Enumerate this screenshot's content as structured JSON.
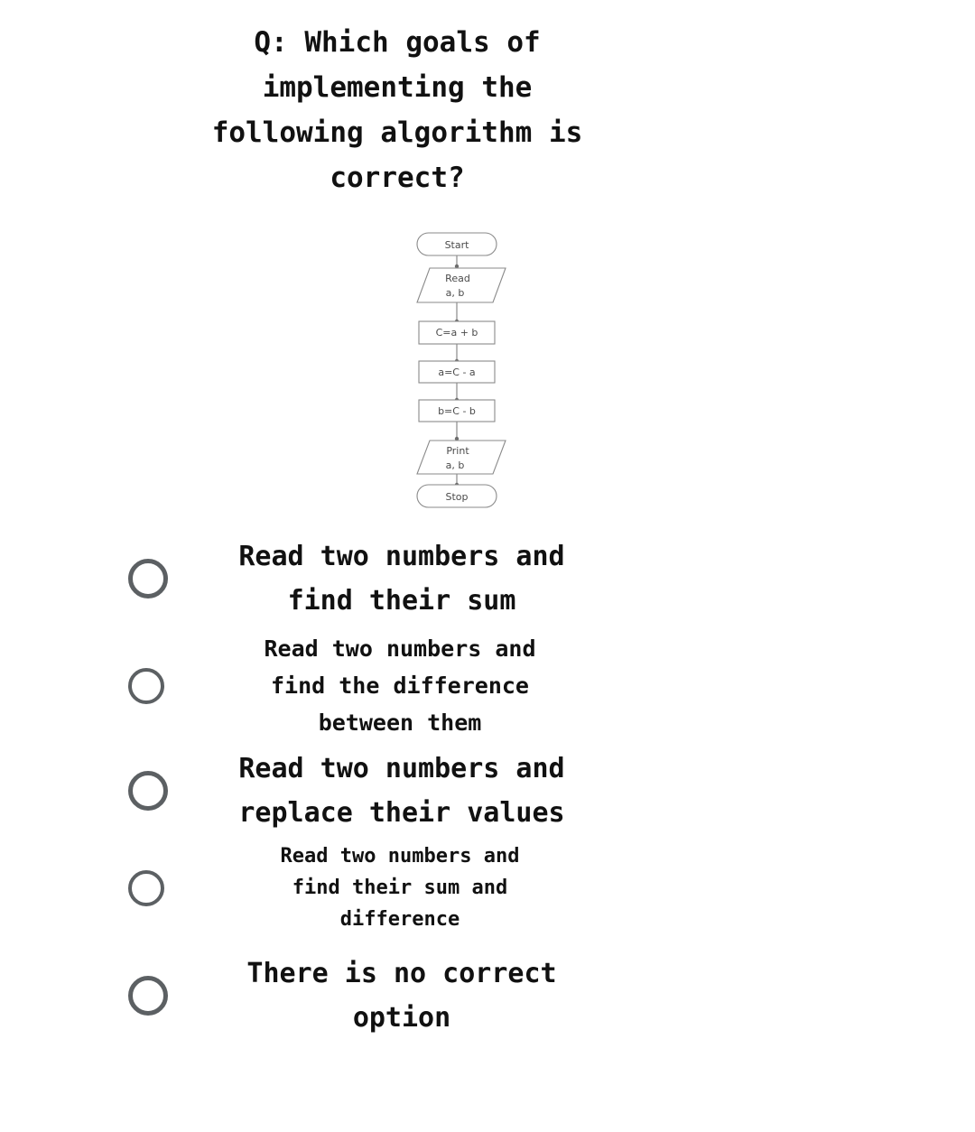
{
  "question": {
    "text": "Q: Which goals of\nimplementing the\nfollowing algorithm is\ncorrect?"
  },
  "flowchart": {
    "nodes": [
      {
        "id": "start",
        "shape": "terminator",
        "label": "Start"
      },
      {
        "id": "read",
        "shape": "parallelogram",
        "label": "Read\na, b"
      },
      {
        "id": "sum",
        "shape": "process",
        "label": "C=a + b"
      },
      {
        "id": "seta",
        "shape": "process",
        "label": "a=C - a"
      },
      {
        "id": "setb",
        "shape": "process",
        "label": "b=C - b"
      },
      {
        "id": "print",
        "shape": "parallelogram",
        "label": "Print\na, b"
      },
      {
        "id": "stop",
        "shape": "terminator",
        "label": "Stop"
      }
    ],
    "labels": {
      "start": "Start",
      "read_line1": "Read",
      "read_line2": "a, b",
      "sum": "C=a + b",
      "seta": "a=C - a",
      "setb": "b=C - b",
      "print_line1": "Print",
      "print_line2": "a, b",
      "stop": "Stop"
    },
    "colors": {
      "stroke": "#8a8a8a",
      "text": "#4a4a4a",
      "fill": "#ffffff"
    }
  },
  "options": [
    {
      "id": "option-1",
      "text": "Read two numbers and\nfind their sum",
      "selected": false
    },
    {
      "id": "option-2",
      "text": "Read two numbers and\nfind the difference\nbetween them",
      "selected": false
    },
    {
      "id": "option-3",
      "text": "Read two numbers and\nreplace their values",
      "selected": false
    },
    {
      "id": "option-4",
      "text": "Read two numbers and\nfind their sum and\ndifference",
      "selected": false
    },
    {
      "id": "option-5",
      "text": "There is no correct\noption",
      "selected": false
    }
  ],
  "colors": {
    "background": "#ffffff",
    "text": "#111111",
    "radio_border": "#5c6063"
  }
}
